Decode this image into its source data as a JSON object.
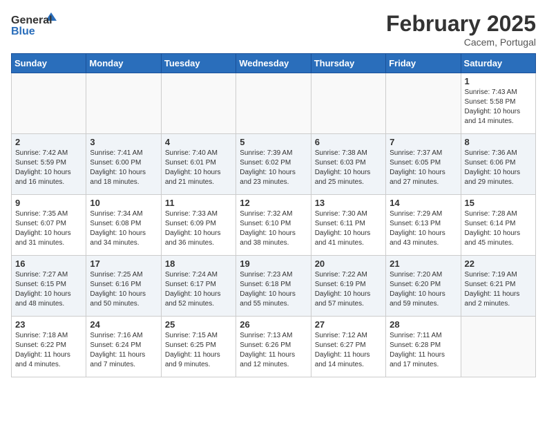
{
  "header": {
    "logo_general": "General",
    "logo_blue": "Blue",
    "title": "February 2025",
    "subtitle": "Cacem, Portugal"
  },
  "weekdays": [
    "Sunday",
    "Monday",
    "Tuesday",
    "Wednesday",
    "Thursday",
    "Friday",
    "Saturday"
  ],
  "weeks": [
    [
      {
        "day": "",
        "info": ""
      },
      {
        "day": "",
        "info": ""
      },
      {
        "day": "",
        "info": ""
      },
      {
        "day": "",
        "info": ""
      },
      {
        "day": "",
        "info": ""
      },
      {
        "day": "",
        "info": ""
      },
      {
        "day": "1",
        "info": "Sunrise: 7:43 AM\nSunset: 5:58 PM\nDaylight: 10 hours and 14 minutes."
      }
    ],
    [
      {
        "day": "2",
        "info": "Sunrise: 7:42 AM\nSunset: 5:59 PM\nDaylight: 10 hours and 16 minutes."
      },
      {
        "day": "3",
        "info": "Sunrise: 7:41 AM\nSunset: 6:00 PM\nDaylight: 10 hours and 18 minutes."
      },
      {
        "day": "4",
        "info": "Sunrise: 7:40 AM\nSunset: 6:01 PM\nDaylight: 10 hours and 21 minutes."
      },
      {
        "day": "5",
        "info": "Sunrise: 7:39 AM\nSunset: 6:02 PM\nDaylight: 10 hours and 23 minutes."
      },
      {
        "day": "6",
        "info": "Sunrise: 7:38 AM\nSunset: 6:03 PM\nDaylight: 10 hours and 25 minutes."
      },
      {
        "day": "7",
        "info": "Sunrise: 7:37 AM\nSunset: 6:05 PM\nDaylight: 10 hours and 27 minutes."
      },
      {
        "day": "8",
        "info": "Sunrise: 7:36 AM\nSunset: 6:06 PM\nDaylight: 10 hours and 29 minutes."
      }
    ],
    [
      {
        "day": "9",
        "info": "Sunrise: 7:35 AM\nSunset: 6:07 PM\nDaylight: 10 hours and 31 minutes."
      },
      {
        "day": "10",
        "info": "Sunrise: 7:34 AM\nSunset: 6:08 PM\nDaylight: 10 hours and 34 minutes."
      },
      {
        "day": "11",
        "info": "Sunrise: 7:33 AM\nSunset: 6:09 PM\nDaylight: 10 hours and 36 minutes."
      },
      {
        "day": "12",
        "info": "Sunrise: 7:32 AM\nSunset: 6:10 PM\nDaylight: 10 hours and 38 minutes."
      },
      {
        "day": "13",
        "info": "Sunrise: 7:30 AM\nSunset: 6:11 PM\nDaylight: 10 hours and 41 minutes."
      },
      {
        "day": "14",
        "info": "Sunrise: 7:29 AM\nSunset: 6:13 PM\nDaylight: 10 hours and 43 minutes."
      },
      {
        "day": "15",
        "info": "Sunrise: 7:28 AM\nSunset: 6:14 PM\nDaylight: 10 hours and 45 minutes."
      }
    ],
    [
      {
        "day": "16",
        "info": "Sunrise: 7:27 AM\nSunset: 6:15 PM\nDaylight: 10 hours and 48 minutes."
      },
      {
        "day": "17",
        "info": "Sunrise: 7:25 AM\nSunset: 6:16 PM\nDaylight: 10 hours and 50 minutes."
      },
      {
        "day": "18",
        "info": "Sunrise: 7:24 AM\nSunset: 6:17 PM\nDaylight: 10 hours and 52 minutes."
      },
      {
        "day": "19",
        "info": "Sunrise: 7:23 AM\nSunset: 6:18 PM\nDaylight: 10 hours and 55 minutes."
      },
      {
        "day": "20",
        "info": "Sunrise: 7:22 AM\nSunset: 6:19 PM\nDaylight: 10 hours and 57 minutes."
      },
      {
        "day": "21",
        "info": "Sunrise: 7:20 AM\nSunset: 6:20 PM\nDaylight: 10 hours and 59 minutes."
      },
      {
        "day": "22",
        "info": "Sunrise: 7:19 AM\nSunset: 6:21 PM\nDaylight: 11 hours and 2 minutes."
      }
    ],
    [
      {
        "day": "23",
        "info": "Sunrise: 7:18 AM\nSunset: 6:22 PM\nDaylight: 11 hours and 4 minutes."
      },
      {
        "day": "24",
        "info": "Sunrise: 7:16 AM\nSunset: 6:24 PM\nDaylight: 11 hours and 7 minutes."
      },
      {
        "day": "25",
        "info": "Sunrise: 7:15 AM\nSunset: 6:25 PM\nDaylight: 11 hours and 9 minutes."
      },
      {
        "day": "26",
        "info": "Sunrise: 7:13 AM\nSunset: 6:26 PM\nDaylight: 11 hours and 12 minutes."
      },
      {
        "day": "27",
        "info": "Sunrise: 7:12 AM\nSunset: 6:27 PM\nDaylight: 11 hours and 14 minutes."
      },
      {
        "day": "28",
        "info": "Sunrise: 7:11 AM\nSunset: 6:28 PM\nDaylight: 11 hours and 17 minutes."
      },
      {
        "day": "",
        "info": ""
      }
    ]
  ]
}
